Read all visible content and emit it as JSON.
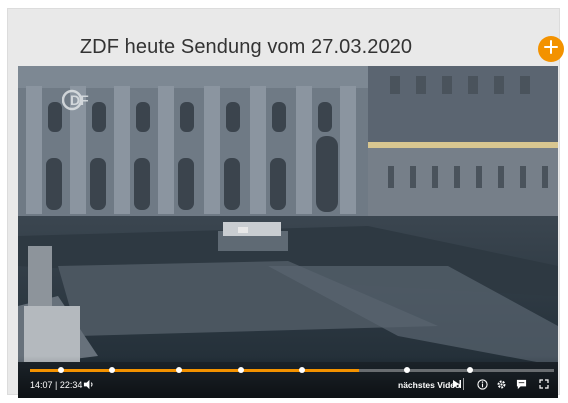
{
  "header": {
    "title": "ZDF heute Sendung vom 27.03.2020",
    "add_icon": "plus-icon",
    "accent_color": "#f39200"
  },
  "player": {
    "logo_text": "2DF",
    "progress_fraction": 0.627,
    "chapter_fractions": [
      0.06,
      0.157,
      0.284,
      0.403,
      0.52,
      0.72,
      0.84
    ],
    "current_time": "14:07",
    "total_time": "22:34",
    "time_display": "14:07 | 22:34",
    "next_video_label": "nächstes Video",
    "icons": [
      "volume-icon",
      "skip-next-icon",
      "info-icon",
      "settings-icon",
      "subtitles-icon",
      "fullscreen-icon"
    ]
  }
}
